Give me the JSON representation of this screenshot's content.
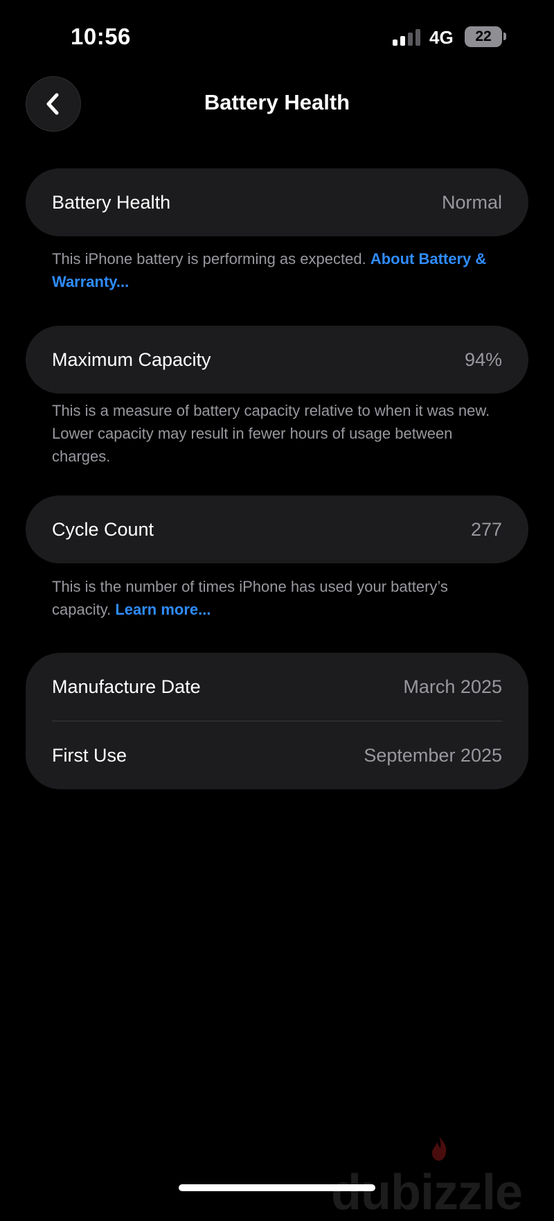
{
  "status_bar": {
    "time": "10:56",
    "network": "4G",
    "battery_level": "22",
    "signal_bars_active": 2,
    "signal_bars_total": 4
  },
  "nav": {
    "back_icon": "chevron-left-icon",
    "title": "Battery Health"
  },
  "battery_health": {
    "label": "Battery Health",
    "value": "Normal",
    "footnote": "This iPhone battery is performing as expected.",
    "footnote_link": "About Battery & Warranty..."
  },
  "maximum_capacity": {
    "label": "Maximum Capacity",
    "value": "94%",
    "footnote": "This is a measure of battery capacity relative to when it was new. Lower capacity may result in fewer hours of usage between charges."
  },
  "cycle_count": {
    "label": "Cycle Count",
    "value": "277",
    "footnote": "This is the number of times iPhone has used your battery’s capacity.",
    "footnote_link": "Learn more..."
  },
  "dates": {
    "manufacture_label": "Manufacture Date",
    "manufacture_value": "March 2025",
    "first_use_label": "First Use",
    "first_use_value": "September 2025"
  },
  "watermark": {
    "text": "dubizzle"
  },
  "colors": {
    "background": "#000000",
    "card": "#1c1c1e",
    "secondary_text": "#98989f",
    "link": "#2f8cff"
  }
}
